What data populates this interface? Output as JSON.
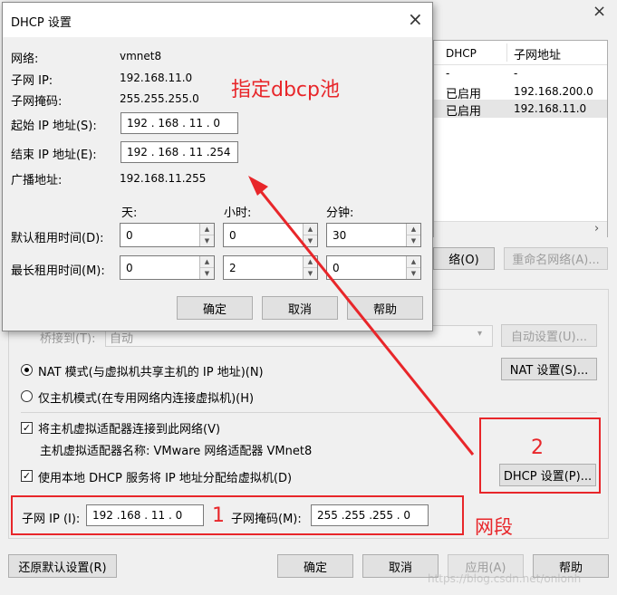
{
  "dhcp_dialog": {
    "title": "DHCP 设置",
    "close_symbol": "×",
    "network_label": "网络:",
    "network_value": "vmnet8",
    "subnet_ip_label": "子网 IP:",
    "subnet_ip_value": "192.168.11.0",
    "subnet_mask_label": "子网掩码:",
    "subnet_mask_value": "255.255.255.0",
    "start_ip_label": "起始 IP 地址(S):",
    "start_ip_value": "192 . 168 . 11 . 0",
    "end_ip_label": "结束 IP 地址(E):",
    "end_ip_value": "192 . 168 . 11 .254",
    "broadcast_label": "广播地址:",
    "broadcast_value": "192.168.11.255",
    "col_days": "天:",
    "col_hours": "小时:",
    "col_minutes": "分钟:",
    "default_lease_label": "默认租用时间(D):",
    "default_lease_days": "0",
    "default_lease_hours": "0",
    "default_lease_minutes": "30",
    "max_lease_label": "最长租用时间(M):",
    "max_lease_days": "0",
    "max_lease_hours": "2",
    "max_lease_minutes": "0",
    "ok": "确定",
    "cancel": "取消",
    "help": "帮助"
  },
  "network_table": {
    "headers": [
      "DHCP",
      "子网地址"
    ],
    "rows": [
      [
        "-",
        "-"
      ],
      [
        "已启用",
        "192.168.200.0"
      ],
      [
        "已启用",
        "192.168.11.0"
      ]
    ]
  },
  "main": {
    "remove_network_btn": "络(O)",
    "rename_network_btn": "重命名网络(A)...",
    "bridge_label": "桥接到(T):",
    "bridge_value": "自动",
    "auto_settings_btn": "自动设置(U)...",
    "nat_label": "NAT 模式(与虚拟机共享主机的 IP 地址)(N)",
    "nat_settings_btn": "NAT 设置(S)...",
    "host_only_label": "仅主机模式(在专用网络内连接虚拟机)(H)",
    "connect_adapter_label": "将主机虚拟适配器连接到此网络(V)",
    "adapter_name_label": "主机虚拟适配器名称: VMware 网络适配器 VMnet8",
    "use_dhcp_label": "使用本地 DHCP 服务将 IP 地址分配给虚拟机(D)",
    "dhcp_settings_btn": "DHCP 设置(P)...",
    "subnet_ip_label": "子网 IP (I):",
    "subnet_ip_value": "192 .168 . 11 . 0",
    "subnet_mask_label": "子网掩码(M):",
    "subnet_mask_value": "255 .255 .255 . 0",
    "restore_defaults_btn": "还原默认设置(R)",
    "ok": "确定",
    "cancel": "取消",
    "apply": "应用(A)",
    "help": "帮助"
  },
  "annotations": {
    "pool_note": "指定dbcp池",
    "num1": "1",
    "num2": "2",
    "segment_note": "网段",
    "watermark": "https://blog.csdn.net/onlonh"
  },
  "colors": {
    "annotation_red": "#e8262a",
    "selected_row": "#e5e5e5"
  }
}
